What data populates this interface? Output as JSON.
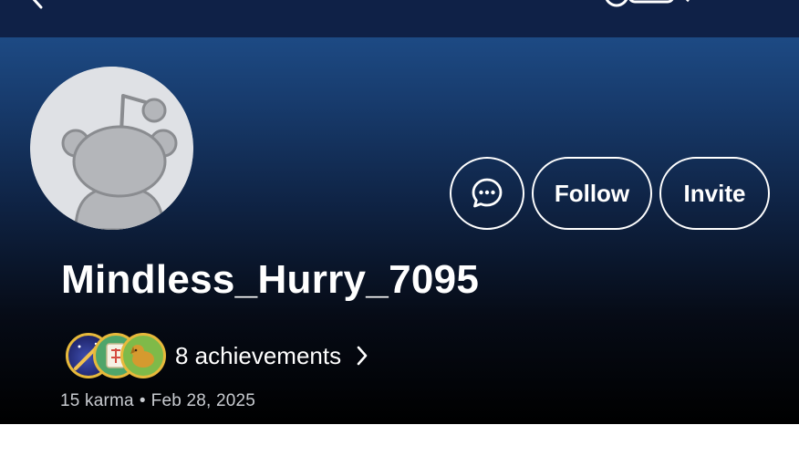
{
  "profile": {
    "username": "Mindless_Hurry_7095",
    "karma": "15 karma",
    "separator": "•",
    "joined": "Feb 28, 2025"
  },
  "actions": {
    "follow_label": "Follow",
    "invite_label": "Invite"
  },
  "achievements": {
    "label": "8 achievements",
    "badges": [
      "space-badge",
      "mahjong-badge",
      "dog-badge"
    ]
  },
  "icons": {
    "back": "back-arrow-icon",
    "chat": "chat-bubble-icon",
    "chevron": "chevron-right-icon",
    "avatar": "snoo-avatar"
  },
  "colors": {
    "topbar": "#0f2147",
    "hero_top": "#1d4a84",
    "hero_bottom": "#000000",
    "text": "#ffffff",
    "meta_text": "#c9ccd1",
    "badge_gold": "#e7b93b"
  }
}
